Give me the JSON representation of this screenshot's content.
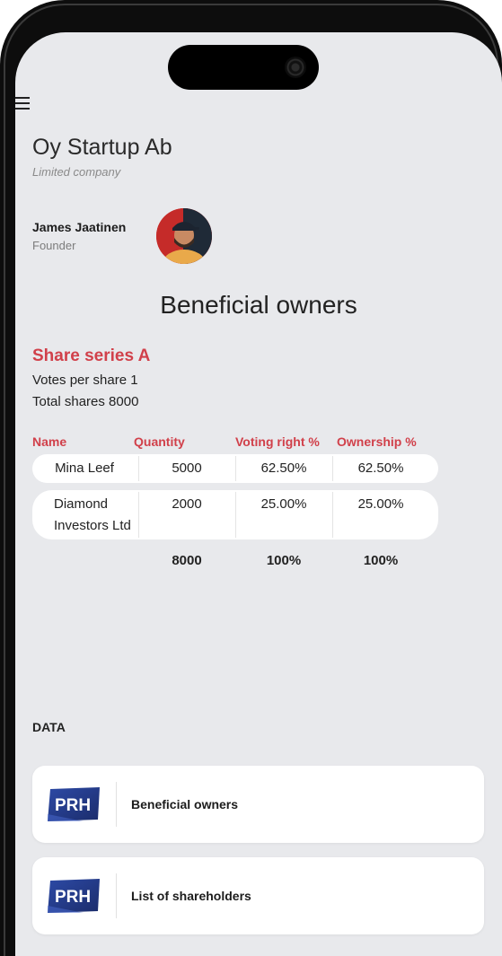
{
  "company": {
    "name": "Oy Startup Ab",
    "type": "Limited company"
  },
  "person": {
    "name": "James Jaatinen",
    "role": "Founder"
  },
  "page_title": "Beneficial owners",
  "series": {
    "title": "Share series A",
    "votes_per_share": "Votes per share 1",
    "total_shares": "Total shares 8000"
  },
  "table": {
    "headers": [
      "Name",
      "Quantity",
      "Voting right %",
      "Ownership %"
    ],
    "rows": [
      {
        "name": "Mina Leef",
        "name_line2": "",
        "quantity": "5000",
        "voting": "62.50%",
        "ownership": "62.50%"
      },
      {
        "name": "Diamond",
        "name_line2": "Investors Ltd",
        "quantity": "2000",
        "voting": "25.00%",
        "ownership": "25.00%"
      }
    ],
    "totals": {
      "quantity": "8000",
      "voting": "100%",
      "ownership": "100%"
    }
  },
  "data_section": {
    "label": "DATA",
    "items": [
      {
        "logo": "PRH",
        "label": "Beneficial owners"
      },
      {
        "logo": "PRH",
        "label": "List of shareholders"
      }
    ]
  },
  "colors": {
    "accent": "#d1404a",
    "background": "#e8e9ec",
    "logo_blue": "#2a3f8f"
  }
}
